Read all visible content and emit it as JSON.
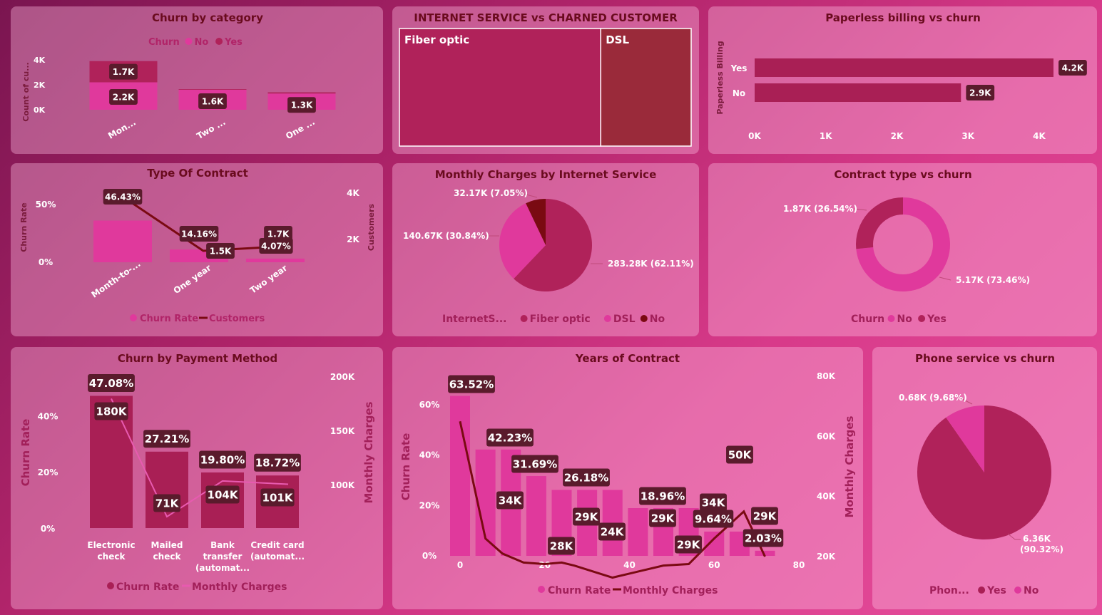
{
  "colors": {
    "dark_red": "#7a0a12",
    "maroon": "#a91f55",
    "pink": "#e0399c",
    "label_bg": "#5a1b2c",
    "title": "#6a0b1e"
  },
  "chart_data": [
    {
      "id": "churn_category",
      "type": "bar",
      "title": "Churn by category",
      "legend": {
        "title": "Churn",
        "items": [
          {
            "name": "No",
            "color": "#e0399c"
          },
          {
            "name": "Yes",
            "color": "#b0225a"
          }
        ]
      },
      "ylabel": "Count of cu...",
      "yticks": [
        "0K",
        "2K",
        "4K"
      ],
      "ylim": [
        0,
        4000
      ],
      "categories": [
        "Mon...",
        "Two ...",
        "One ..."
      ],
      "series": [
        {
          "name": "No",
          "values": [
            2200,
            1600,
            1300
          ],
          "labels": [
            "2.2K",
            "1.6K",
            "1.3K"
          ]
        },
        {
          "name": "Yes",
          "values": [
            1700,
            50,
            100
          ],
          "labels": [
            "1.7K",
            "",
            ""
          ]
        }
      ]
    },
    {
      "id": "internet_treemap",
      "type": "treemap",
      "title": "INTERNET SERVICE vs CHARNED CUSTOMER",
      "items": [
        {
          "name": "Fiber optic",
          "share": 0.69,
          "color": "#b0225a"
        },
        {
          "name": "DSL",
          "share": 0.31,
          "color": "#9a2a3a"
        }
      ]
    },
    {
      "id": "paperless",
      "type": "bar",
      "orientation": "horizontal",
      "title": "Paperless billing vs churn",
      "ylabel": "Paperless Billing",
      "categories": [
        "Yes",
        "No"
      ],
      "values": [
        4200,
        2900
      ],
      "labels": [
        "4.2K",
        "2.9K"
      ],
      "xticks": [
        "0K",
        "1K",
        "2K",
        "3K",
        "4K"
      ],
      "xlim": [
        0,
        4000
      ]
    },
    {
      "id": "contract_type",
      "type": "bar",
      "title": "Type Of Contract",
      "categories": [
        "Month-to-...",
        "One year",
        "Two year"
      ],
      "ylabel": "Churn Rate",
      "yticks": [
        "0%",
        "50%"
      ],
      "y2label": "Customers",
      "y2ticks": [
        "2K",
        "4K"
      ],
      "series": [
        {
          "name": "Churn Rate",
          "values": [
            46.43,
            14.16,
            4.07
          ],
          "labels": [
            "46.43%",
            "14.16%",
            "4.07%"
          ]
        },
        {
          "name": "Customers",
          "values": [
            3900,
            1500,
            1700
          ],
          "labels": [
            "",
            "1.5K",
            "1.7K"
          ]
        }
      ],
      "legend": [
        "Churn Rate",
        "Customers"
      ]
    },
    {
      "id": "monthly_internet",
      "type": "pie",
      "title": "Monthly Charges by Internet Service",
      "legend": {
        "title": "InternetS...",
        "items": [
          "Fiber optic",
          "DSL",
          "No"
        ]
      },
      "slices": [
        {
          "name": "Fiber optic",
          "value": 283.28,
          "label": "283.28K (62.11%)",
          "pct": 62.11,
          "color": "#b0225a"
        },
        {
          "name": "DSL",
          "value": 140.67,
          "label": "140.67K (30.84%)",
          "pct": 30.84,
          "color": "#e0399c"
        },
        {
          "name": "No",
          "value": 32.17,
          "label": "32.17K (7.05%)",
          "pct": 7.05,
          "color": "#7a0a12"
        }
      ]
    },
    {
      "id": "contract_vs_churn",
      "type": "donut",
      "title": "Contract type vs churn",
      "legend": {
        "title": "Churn",
        "items": [
          "No",
          "Yes"
        ]
      },
      "slices": [
        {
          "name": "No",
          "value": 5.17,
          "label": "5.17K (73.46%)",
          "pct": 73.46,
          "color": "#e0399c"
        },
        {
          "name": "Yes",
          "value": 1.87,
          "label": "1.87K (26.54%)",
          "pct": 26.54,
          "color": "#b0225a"
        }
      ]
    },
    {
      "id": "payment_method",
      "type": "bar",
      "title": "Churn by Payment Method",
      "categories": [
        [
          "Electronic",
          "check"
        ],
        [
          "Mailed",
          "check"
        ],
        [
          "Bank",
          "transfer",
          "(automat..."
        ],
        [
          "Credit card",
          "(automat..."
        ]
      ],
      "ylabel": "Churn Rate",
      "yticks": [
        "0%",
        "20%",
        "40%"
      ],
      "ylim": [
        0,
        50
      ],
      "y2label": "Monthly Charges",
      "y2ticks": [
        "100K",
        "150K",
        "200K"
      ],
      "y2lim": [
        50000,
        200000
      ],
      "series": [
        {
          "name": "Churn Rate",
          "values": [
            47.08,
            27.21,
            19.8,
            18.72
          ],
          "labels": [
            "47.08%",
            "27.21%",
            "19.80%",
            "18.72%"
          ]
        },
        {
          "name": "Monthly Charges",
          "values": [
            180000,
            71000,
            104000,
            101000
          ],
          "labels": [
            "180K",
            "71K",
            "104K",
            "101K"
          ]
        }
      ],
      "legend": [
        "Churn Rate",
        "Monthly Charges"
      ]
    },
    {
      "id": "years_contract",
      "type": "bar",
      "title": "Years of Contract",
      "ylabel": "Churn Rate",
      "yticks": [
        "0%",
        "20%",
        "40%",
        "60%"
      ],
      "ylim": [
        0,
        70
      ],
      "y2label": "Monthly Charges",
      "y2ticks": [
        "20K",
        "40K",
        "60K",
        "80K"
      ],
      "y2lim": [
        20000,
        80000
      ],
      "xticks": [
        "0",
        "20",
        "40",
        "60",
        "80"
      ],
      "xlim": [
        0,
        80
      ],
      "x": [
        0,
        6,
        12,
        18,
        24,
        30,
        36,
        42,
        48,
        54,
        60,
        66,
        72
      ],
      "series": [
        {
          "name": "Churn Rate",
          "values": [
            63.52,
            42.23,
            42.23,
            31.69,
            26.18,
            26.18,
            26.18,
            18.96,
            18.96,
            18.96,
            9.64,
            9.64,
            2.03
          ]
        },
        {
          "name": "Monthly Charges",
          "values": [
            65000,
            26000,
            21000,
            29000,
            28000,
            29000,
            24000,
            29000,
            29000,
            29000,
            34000,
            50000,
            29000
          ]
        }
      ],
      "rate_labels": [
        {
          "i": 0,
          "t": "63.52%"
        },
        {
          "i": 1,
          "t": "42.23%"
        },
        {
          "i": 3,
          "t": "31.69%"
        },
        {
          "i": 4,
          "t": "26.18%"
        },
        {
          "i": 8,
          "t": "18.96%"
        },
        {
          "i": 10,
          "t": "9.64%"
        },
        {
          "i": 12,
          "t": "2.03%"
        }
      ],
      "charge_labels": [
        {
          "i": 1,
          "t": "34K"
        },
        {
          "i": 3,
          "t": "28K"
        },
        {
          "i": 4,
          "t": "29K"
        },
        {
          "i": 5,
          "t": "24K"
        },
        {
          "i": 7,
          "t": "29K"
        },
        {
          "i": 9,
          "t": "29K"
        },
        {
          "i": 10,
          "t": "34K"
        },
        {
          "i": 11,
          "t": "50K"
        },
        {
          "i": 12,
          "t": "29K"
        }
      ],
      "legend": [
        "Churn Rate",
        "Monthly Charges"
      ]
    },
    {
      "id": "phone_service",
      "type": "pie",
      "title": "Phone service vs churn",
      "legend": {
        "title": "Phon...",
        "items": [
          "Yes",
          "No"
        ]
      },
      "slices": [
        {
          "name": "Yes",
          "value": 6.36,
          "label": [
            "6.36K",
            "(90.32%)"
          ],
          "pct": 90.32,
          "color": "#b0225a"
        },
        {
          "name": "No",
          "value": 0.68,
          "label": "0.68K (9.68%)",
          "pct": 9.68,
          "color": "#e0399c"
        }
      ]
    }
  ]
}
